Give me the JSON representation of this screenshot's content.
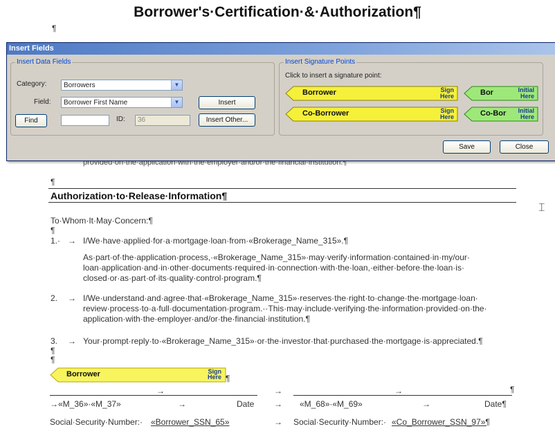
{
  "document": {
    "title": "Borrower's·Certification·&·Authorization¶",
    "pilcrow": "¶",
    "partial_line": "provided·on·the·application·with·the·employer·and/or·the·financial·institution.¶",
    "section_heading": "Authorization·to·Release·Information¶",
    "salutation": "To·Whom·It·May·Concern:¶",
    "items": [
      {
        "num": "1.·",
        "arrow": "→",
        "text": "I/We·have·applied·for·a·mortgage·loan·from·«Brokerage_Name_315».¶"
      },
      {
        "continuation": [
          "As·part·of·the·application·process,·«Brokerage_Name_315»·may·verify·information·contained·in·my/our·",
          "loan·application·and·in·other·documents·required·in·connection·with·the·loan,·either·before·the·loan·is·",
          "closed·or·as·part·of·its·quality·control·program.¶"
        ]
      },
      {
        "num": "2.",
        "arrow": "→",
        "lines": [
          "I/We·understand·and·agree·that·«Brokerage_Name_315»·reserves·the·right·to·change·the·mortgage·loan·",
          "review·process·to·a·full·documentation·program.··This·may·include·verifying·the·information·provided·on·the·",
          "application·with·the·employer·and/or·the·financial·institution.¶"
        ]
      },
      {
        "num": "3.",
        "arrow": "→",
        "text": "Your·prompt·reply·to·«Brokerage_Name_315»·or·the·investor·that·purchased·the·mortgage·is·appreciated.¶"
      }
    ],
    "sig_block": {
      "left_fields": "→«M_36»·«M_37»",
      "left_date": "Date",
      "right_fields": "«M_68»·«M_69»",
      "right_date": "Date¶",
      "arrow": "→",
      "ssn_left_label": "Social·Security·Number:·",
      "ssn_left_field": "«Borrower_SSN_65»",
      "ssn_right_label": "Social·Security·Number:·",
      "ssn_right_field": "«Co_Borrower_SSN_97»¶"
    },
    "doc_sign_tag": {
      "name": "Borrower",
      "sub1": "Sign",
      "sub2": "Here"
    }
  },
  "dialog": {
    "title": "Insert Fields",
    "data_fields_group": "Insert Data Fields",
    "category_label": "Category:",
    "category_value": "Borrowers",
    "field_label": "Field:",
    "field_value": "Borrower First Name",
    "insert_button": "Insert",
    "find_button": "Find",
    "id_label": "ID:",
    "id_value": "36",
    "insert_other_button": "Insert Other...",
    "signature_group": "Insert Signature Points",
    "signature_hint": "Click to insert a signature point:",
    "tags": [
      {
        "name": "Borrower",
        "sub1": "Sign",
        "sub2": "Here",
        "color": "yellow"
      },
      {
        "name": "Bor",
        "sub1": "Initial",
        "sub2": "Here",
        "color": "green"
      },
      {
        "name": "Co-Borrower",
        "sub1": "Sign",
        "sub2": "Here",
        "color": "yellow"
      },
      {
        "name": "Co-Bor",
        "sub1": "Initial",
        "sub2": "Here",
        "color": "green"
      }
    ],
    "save_button": "Save",
    "close_button": "Close"
  },
  "colors": {
    "dialog_bg": "#d4d0c8",
    "title_bar": "#4d79c4",
    "group_label": "#0046d5",
    "sign_tag": "#f5f03a",
    "initial_tag": "#9ee87a"
  },
  "icons": {
    "cursor": "text-cursor-icon",
    "dropdown": "chevron-down-icon"
  }
}
